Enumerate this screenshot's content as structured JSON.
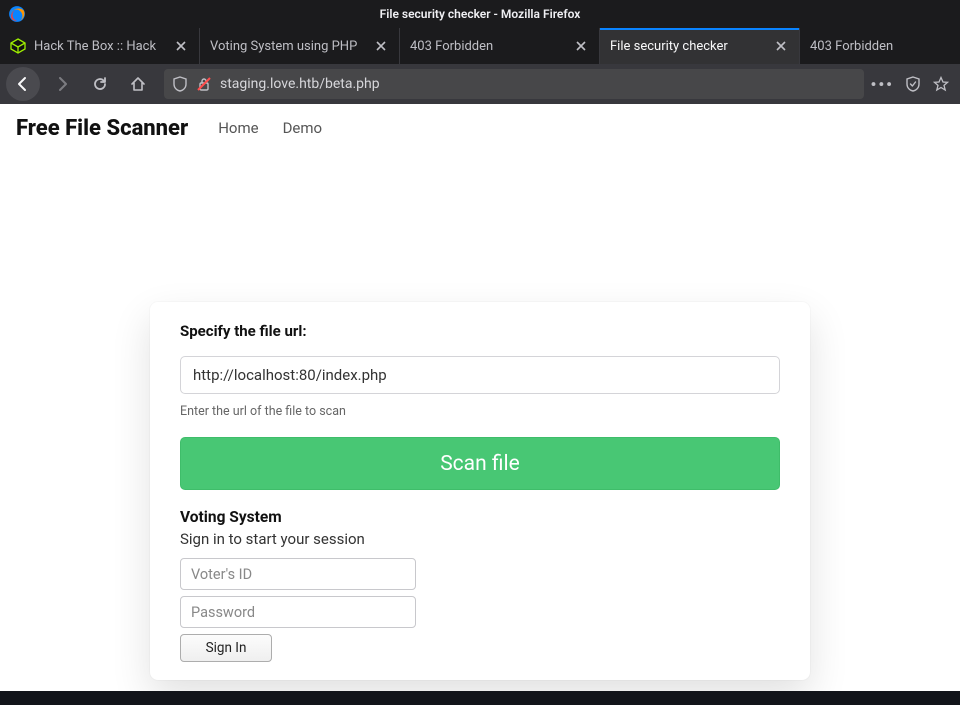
{
  "window": {
    "title": "File security checker - Mozilla Firefox"
  },
  "tabs": [
    {
      "label": "Hack The Box :: Hack",
      "active": false,
      "closable": true,
      "favicon": "htb"
    },
    {
      "label": "Voting System using PHP",
      "active": false,
      "closable": true,
      "favicon": "none"
    },
    {
      "label": "403 Forbidden",
      "active": false,
      "closable": true,
      "favicon": "none"
    },
    {
      "label": "File security checker",
      "active": true,
      "closable": true,
      "favicon": "none"
    },
    {
      "label": "403 Forbidden",
      "active": false,
      "closable": false,
      "favicon": "none"
    }
  ],
  "address_bar": {
    "url": "staging.love.htb/beta.php"
  },
  "page": {
    "brand": "Free File Scanner",
    "nav": {
      "home": "Home",
      "demo": "Demo"
    },
    "form": {
      "prompt": "Specify the file url:",
      "input_value": "http://localhost:80/index.php",
      "hint": "Enter the url of the file to scan",
      "scan_button": "Scan file"
    },
    "result": {
      "title": "Voting System",
      "subtitle": "Sign in to start your session",
      "voter_placeholder": "Voter's ID",
      "password_placeholder": "Password",
      "signin": "Sign In"
    }
  }
}
